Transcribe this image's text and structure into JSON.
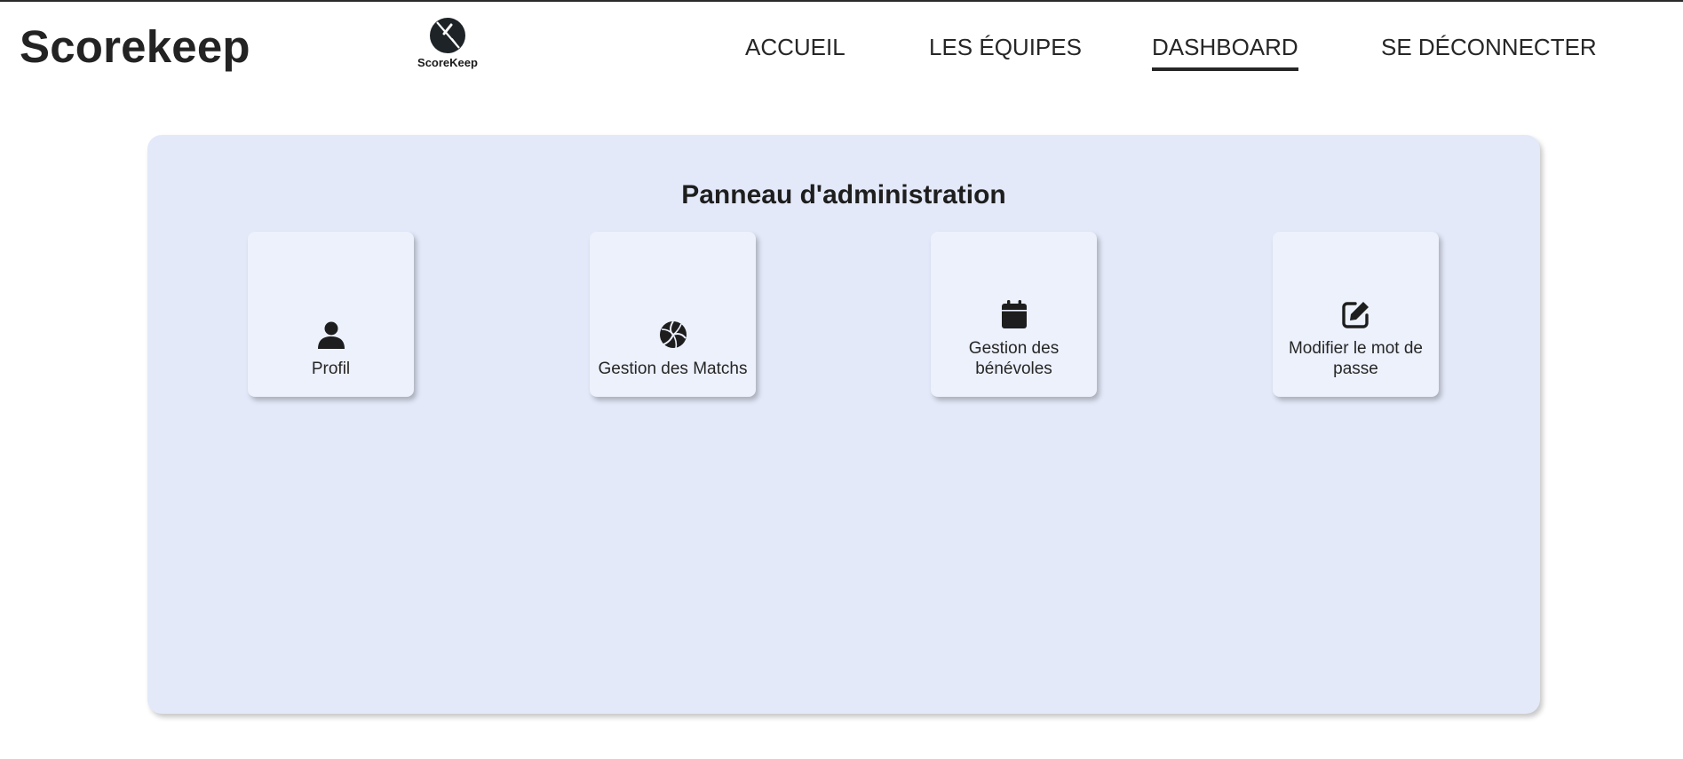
{
  "header": {
    "brand": "Scorekeep",
    "logo_text": "ScoreKeep",
    "nav": [
      {
        "label": "ACCUEIL",
        "active": false
      },
      {
        "label": "LES ÉQUIPES",
        "active": false
      },
      {
        "label": "DASHBOARD",
        "active": true
      },
      {
        "label": "SE DÉCONNECTER",
        "active": false
      }
    ]
  },
  "panel": {
    "title": "Panneau d'administration",
    "cards": [
      {
        "label": "Profil",
        "icon": "user-icon"
      },
      {
        "label": "Gestion des Matchs",
        "icon": "volleyball-icon"
      },
      {
        "label": "Gestion des bénévoles",
        "icon": "calendar-icon"
      },
      {
        "label": "Modifier le mot de passe",
        "icon": "edit-icon"
      }
    ]
  },
  "colors": {
    "panel_bg": "#e3e9f9",
    "card_bg": "#edf1fc",
    "text": "#262626"
  }
}
